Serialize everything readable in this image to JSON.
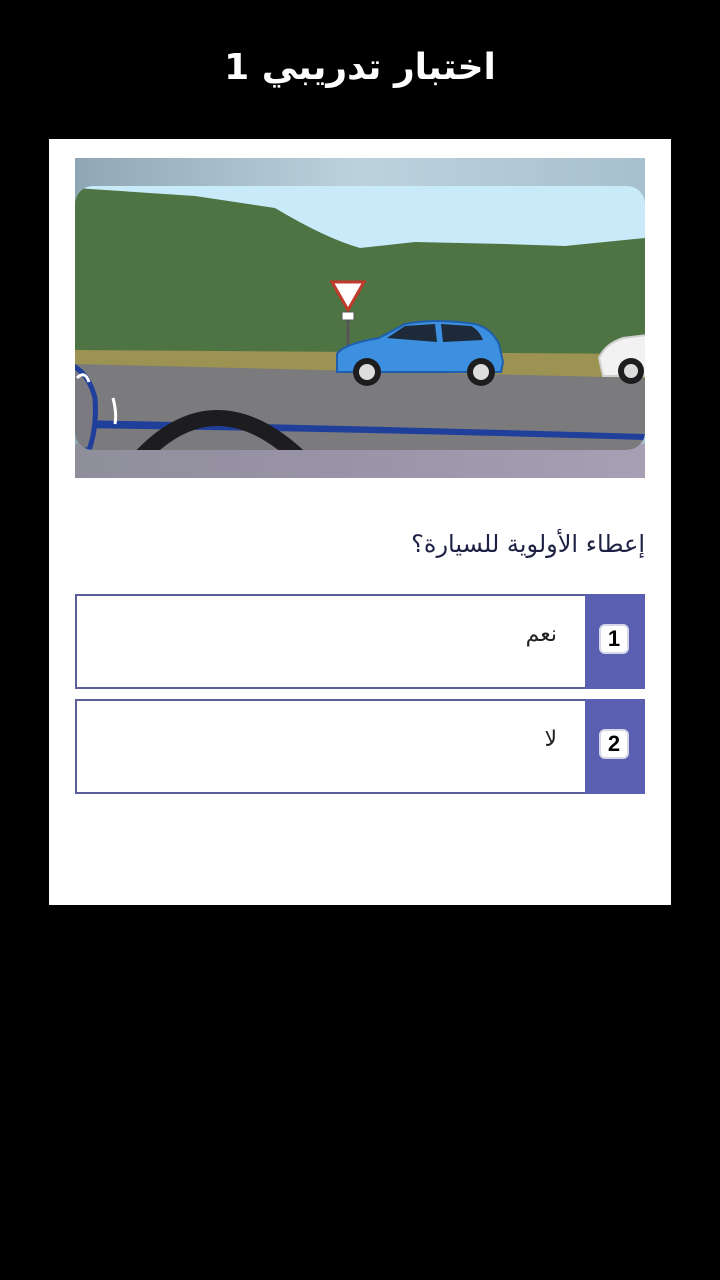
{
  "header": {
    "title": "اختبار تدريبي 1"
  },
  "question": {
    "text": "إعطاء الأولوية للسيارة؟",
    "image": {
      "subject": "road-scene-yield-sign",
      "car_color": "#3d8fe0"
    }
  },
  "options": [
    {
      "number": "1",
      "label": "نعم"
    },
    {
      "number": "2",
      "label": "لا"
    }
  ],
  "colors": {
    "background": "#000000",
    "card": "#ffffff",
    "accent": "#5a5fb2",
    "question_text": "#1e2144"
  }
}
